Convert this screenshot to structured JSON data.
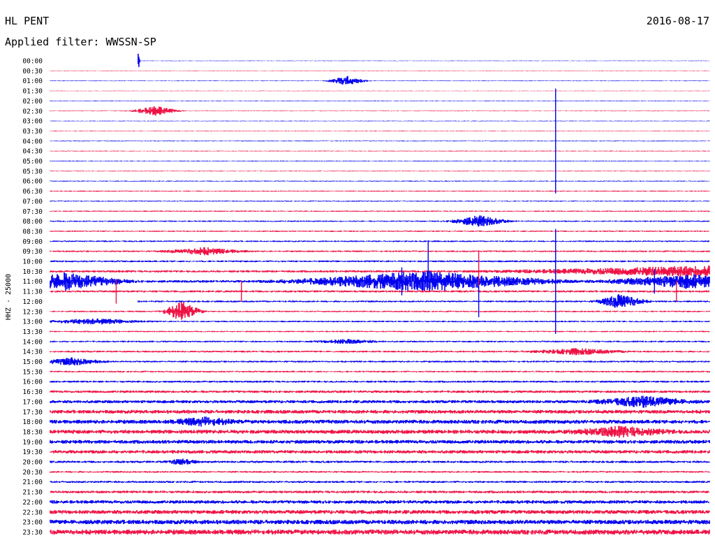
{
  "header": {
    "station": "HL PENT",
    "date": "2016-08-17",
    "filter": "Applied filter: WWSSN-SP"
  },
  "colors": {
    "trace_a": "#0000ee",
    "trace_b": "#ee1144",
    "text": "#000000",
    "background": "#ffffff"
  },
  "chart_data": {
    "type": "line",
    "ylabel": "HHZ - 25000",
    "y_tick_labels": [
      "00:00",
      "00:30",
      "01:00",
      "01:30",
      "02:00",
      "02:30",
      "03:00",
      "03:30",
      "04:00",
      "04:30",
      "05:00",
      "05:30",
      "06:00",
      "06:30",
      "07:00",
      "07:30",
      "08:00",
      "08:30",
      "09:00",
      "09:30",
      "10:00",
      "10:30",
      "11:00",
      "11:30",
      "12:00",
      "12:30",
      "13:00",
      "13:30",
      "14:00",
      "14:30",
      "15:00",
      "15:30",
      "16:00",
      "16:30",
      "17:00",
      "17:30",
      "18:00",
      "18:30",
      "19:00",
      "19:30",
      "20:00",
      "20:30",
      "21:00",
      "21:30",
      "22:00",
      "22:30",
      "23:00",
      "23:30"
    ],
    "trace_minutes": 30,
    "x_start_minutes": [
      4,
      0,
      0,
      0,
      0,
      0,
      0,
      0,
      0,
      0,
      0,
      0,
      0,
      0,
      0,
      0,
      0,
      0,
      0,
      0,
      0,
      0,
      0,
      0,
      4,
      0,
      0,
      0,
      0,
      0,
      0,
      0,
      0,
      0,
      0,
      0,
      0,
      0,
      0,
      0,
      0,
      0,
      0,
      0,
      0,
      0,
      0,
      0
    ],
    "background_amplitude": [
      0.4,
      0.4,
      0.5,
      0.4,
      0.5,
      0.5,
      0.5,
      0.5,
      0.6,
      0.6,
      0.6,
      0.6,
      0.7,
      0.8,
      0.8,
      0.9,
      1.0,
      1.0,
      1.1,
      1.2,
      1.3,
      1.6,
      1.8,
      1.5,
      1.3,
      1.1,
      1.1,
      1.0,
      1.2,
      1.3,
      1.3,
      1.2,
      1.4,
      1.8,
      2.2,
      2.6,
      2.8,
      2.8,
      2.6,
      2.4,
      1.6,
      1.3,
      1.5,
      1.8,
      2.4,
      2.8,
      3.2,
      3.5
    ],
    "events": [
      {
        "trace": "00:00",
        "minute": 4.0,
        "amplitude": 15,
        "duration": 0.1
      },
      {
        "trace": "01:00",
        "minute": 13.5,
        "amplitude": 7,
        "duration": 1.2
      },
      {
        "trace": "02:30",
        "minute": 4.8,
        "amplitude": 7,
        "duration": 1.5
      },
      {
        "trace": "08:00",
        "minute": 19.5,
        "amplitude": 8,
        "duration": 1.8
      },
      {
        "trace": "09:30",
        "minute": 7.0,
        "amplitude": 5,
        "duration": 2.5
      },
      {
        "trace": "10:30",
        "minute": 32.0,
        "amplitude": 9,
        "duration": 14
      },
      {
        "trace": "11:00",
        "minute": 17.0,
        "amplitude": 14,
        "duration": 8
      },
      {
        "trace": "11:00",
        "minute": 0.8,
        "amplitude": 12,
        "duration": 3.5
      },
      {
        "trace": "11:00",
        "minute": 29.0,
        "amplitude": 9,
        "duration": 5
      },
      {
        "trace": "12:00",
        "minute": 26.0,
        "amplitude": 11,
        "duration": 1.5
      },
      {
        "trace": "12:30",
        "minute": 6.0,
        "amplitude": 14,
        "duration": 1.2
      },
      {
        "trace": "13:00",
        "minute": 2.0,
        "amplitude": 4,
        "duration": 3
      },
      {
        "trace": "14:00",
        "minute": 13.5,
        "amplitude": 3,
        "duration": 2
      },
      {
        "trace": "14:30",
        "minute": 24.0,
        "amplitude": 4,
        "duration": 3
      },
      {
        "trace": "15:00",
        "minute": 1.0,
        "amplitude": 5,
        "duration": 2
      },
      {
        "trace": "17:00",
        "minute": 27.0,
        "amplitude": 7,
        "duration": 3
      },
      {
        "trace": "18:30",
        "minute": 26.0,
        "amplitude": 6,
        "duration": 3
      },
      {
        "trace": "18:00",
        "minute": 7.0,
        "amplitude": 5,
        "duration": 2
      },
      {
        "trace": "20:00",
        "minute": 6.0,
        "amplitude": 4,
        "duration": 1
      }
    ],
    "spikes": [
      {
        "trace": "04:00",
        "minute": 23.0,
        "height": 150
      },
      {
        "trace": "11:00",
        "minute": 23.0,
        "height": 150
      },
      {
        "trace": "10:00",
        "minute": 17.2,
        "height": 60
      },
      {
        "trace": "10:30",
        "minute": 19.5,
        "height": 60
      },
      {
        "trace": "12:00",
        "minute": 19.5,
        "height": 45
      },
      {
        "trace": "11:00",
        "minute": 16.0,
        "height": 40
      },
      {
        "trace": "11:00",
        "minute": 27.5,
        "height": 35
      },
      {
        "trace": "11:30",
        "minute": 3.0,
        "height": 35
      },
      {
        "trace": "11:30",
        "minute": 8.7,
        "height": 30
      },
      {
        "trace": "11:30",
        "minute": 28.5,
        "height": 30
      }
    ]
  }
}
